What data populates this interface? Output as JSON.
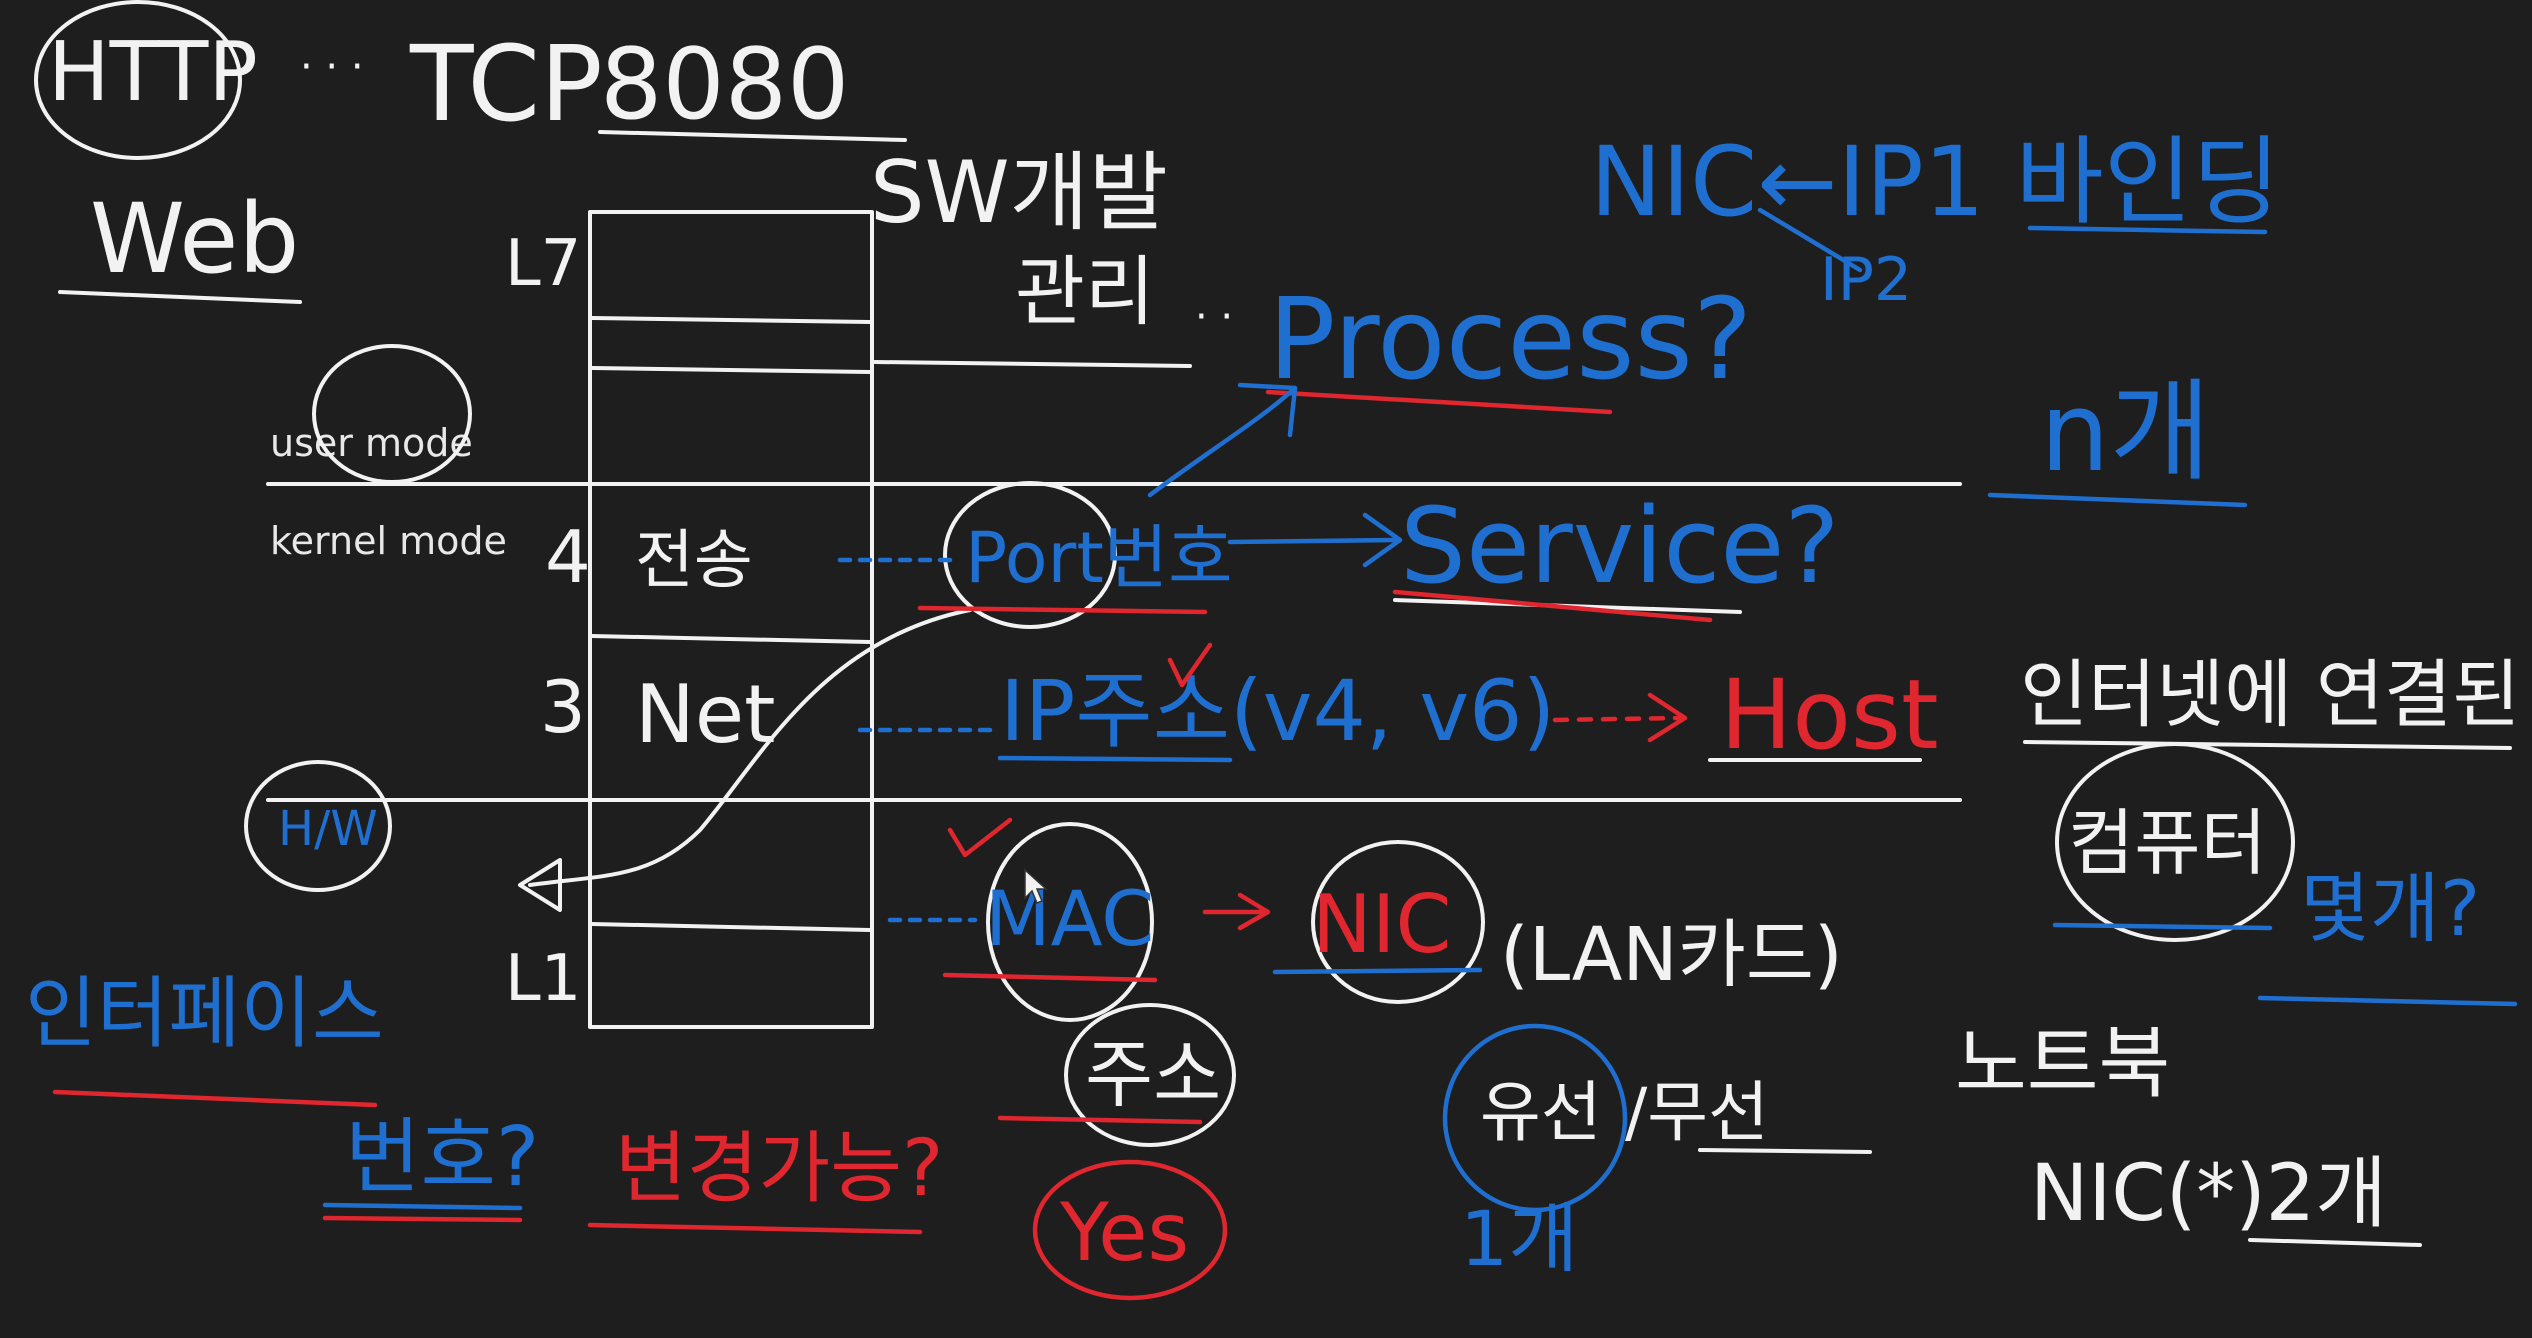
{
  "colors": {
    "background": "#1e1e1e",
    "ink_white": "#f2f2f2",
    "ink_blue": "#1f6fd1",
    "ink_red": "#e0262e"
  },
  "top": {
    "http": "HTTP",
    "web": "Web",
    "tcp": "TCP",
    "number": "8080",
    "sw": "SW개발"
  },
  "layers": {
    "l7": "L7",
    "l4": "4",
    "l4_text": "전송",
    "l3": "3",
    "l3_text": "Net",
    "l1": "L1"
  },
  "modes": {
    "user": "user mode",
    "kernel": "kernel mode"
  },
  "middle": {
    "manage": "관리",
    "process": "Process?",
    "port": "Port번호",
    "service": "Service?",
    "ip": "IP주소(v4, v6)",
    "host": "Host",
    "mac": "MAC",
    "nic": "NIC",
    "lan": "(LAN카드)",
    "address": "주소",
    "wired": "유선",
    "wireless": "/무선",
    "one": "1개",
    "yes": "Yes",
    "changeable": "변경가능?",
    "number_q": "번호?",
    "interface": "인터페이스",
    "hw": "H/W"
  },
  "right": {
    "nic_ip": "NIC←IP1 바인딩",
    "ip2": "IP2",
    "n_count": "n개",
    "internet": "인터넷에 연결된",
    "computer": "컴퓨터",
    "how_many": "몇개?",
    "notebook": "노트북",
    "nic_2": "NIC(*)2개"
  }
}
